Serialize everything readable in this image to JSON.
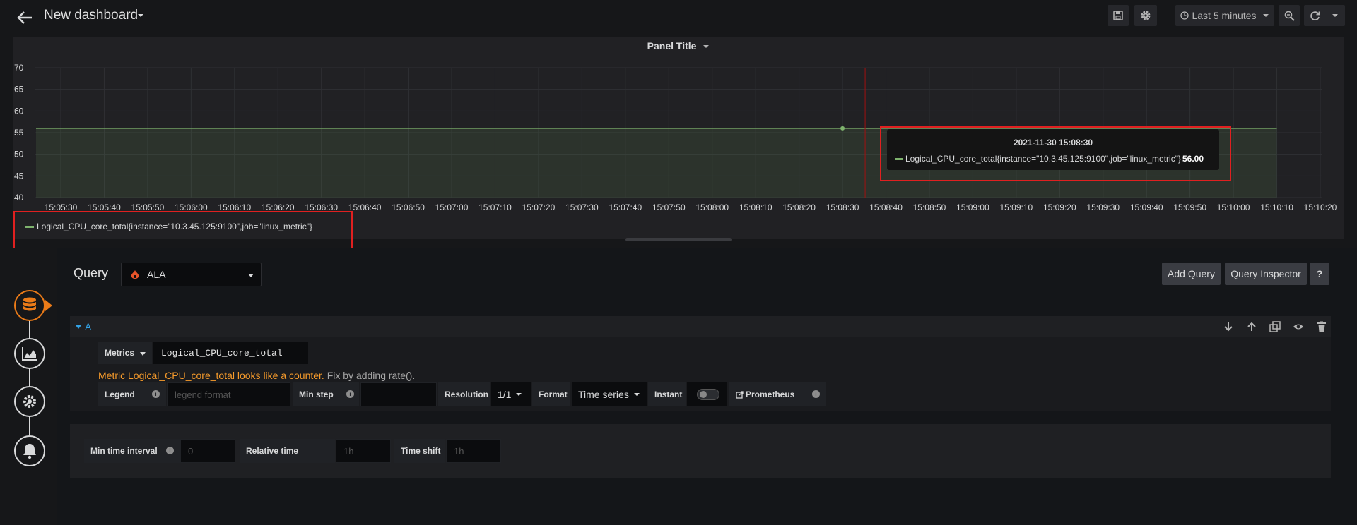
{
  "topbar": {
    "title": "New dashboard",
    "time_range": "Last 5 minutes"
  },
  "panel": {
    "title": "Panel Title",
    "tooltip": {
      "time": "2021-11-30 15:08:30",
      "series": "Logical_CPU_core_total{instance=\"10.3.45.125:9100\",job=\"linux_metric\"}:",
      "value": "56.00"
    },
    "legend": "Logical_CPU_core_total{instance=\"10.3.45.125:9100\",job=\"linux_metric\"}"
  },
  "chart_data": {
    "type": "line",
    "series": [
      {
        "name": "Logical_CPU_core_total{instance=\"10.3.45.125:9100\",job=\"linux_metric\"}",
        "x": [
          "15:05:30",
          "15:10:10"
        ],
        "values": [
          56,
          56
        ]
      }
    ],
    "x_ticks": [
      "15:05:30",
      "15:05:40",
      "15:05:50",
      "15:06:00",
      "15:06:10",
      "15:06:20",
      "15:06:30",
      "15:06:40",
      "15:06:50",
      "15:07:00",
      "15:07:10",
      "15:07:20",
      "15:07:30",
      "15:07:40",
      "15:07:50",
      "15:08:00",
      "15:08:10",
      "15:08:20",
      "15:08:30",
      "15:08:40",
      "15:08:50",
      "15:09:00",
      "15:09:10",
      "15:09:20",
      "15:09:30",
      "15:09:40",
      "15:09:50",
      "15:10:00",
      "15:10:10",
      "15:10:20"
    ],
    "y_ticks": [
      "70",
      "65",
      "60",
      "55",
      "50",
      "45",
      "40"
    ],
    "ylim": [
      40,
      70
    ],
    "hover_x": "15:08:30",
    "line_color": "#7eb26d",
    "grid": true
  },
  "query": {
    "label": "Query",
    "datasource": "ALA",
    "add_query": "Add Query",
    "inspector": "Query Inspector",
    "help": "?"
  },
  "row_a": {
    "ref": "A",
    "metrics_label": "Metrics",
    "metrics_value": "Logical_CPU_core_total",
    "warning": "Metric Logical_CPU_core_total looks like a counter.",
    "warning_link": "Fix by adding rate().",
    "legend_label": "Legend",
    "legend_placeholder": "legend format",
    "min_step_label": "Min step",
    "resolution_label": "Resolution",
    "resolution_value": "1/1",
    "format_label": "Format",
    "format_value": "Time series",
    "instant_label": "Instant",
    "prometheus_label": "Prometheus"
  },
  "options": {
    "min_interval_label": "Min time interval",
    "min_interval_placeholder": "0",
    "relative_label": "Relative time",
    "relative_placeholder": "1h",
    "shift_label": "Time shift",
    "shift_placeholder": "1h"
  },
  "colors": {
    "accent": "#eb7b18",
    "link": "#33a2e5",
    "warning": "#f59a2b",
    "highlight_box": "#e02020"
  }
}
